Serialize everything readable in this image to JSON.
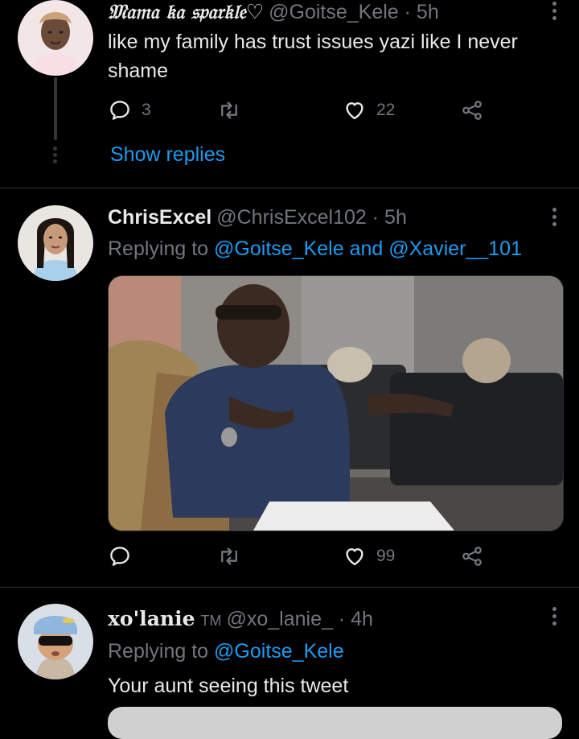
{
  "tweets": [
    {
      "name": "𝔐𝔞𝔪𝔞 𝔨𝔞 𝔰𝔭𝔞𝔯𝔨𝔩𝔢♡",
      "handle": "@Goitse_Kele",
      "time": "· 5h",
      "text": "like my family has trust issues yazi like I never shame",
      "replies": "3",
      "retweets": "",
      "likes": "22",
      "show_replies": "Show replies"
    },
    {
      "name": "ChrisExcel",
      "handle": "@ChrisExcel102",
      "time": "· 5h",
      "replying_prefix": "Replying to",
      "replying_to_1": "@Goitse_Kele",
      "replying_and": "and",
      "replying_to_2": "@Xavier__101",
      "replies": "",
      "retweets": "",
      "likes": "99"
    },
    {
      "name": "xo'lanie",
      "tm": "TM",
      "handle": "@xo_lanie_",
      "time": "· 4h",
      "replying_prefix": "Replying to",
      "replying_to_1": "@Goitse_Kele",
      "text": "Your aunt seeing this tweet"
    }
  ],
  "icons": {
    "reply": "speech-bubble",
    "retweet": "retweet-arrows",
    "like": "heart-outline",
    "share": "share-nodes",
    "more": "vertical-ellipsis"
  },
  "colors": {
    "background": "#000000",
    "text": "#e7e9ea",
    "muted": "#71767b",
    "link": "#1d9bf0",
    "divider": "#2f3336"
  }
}
